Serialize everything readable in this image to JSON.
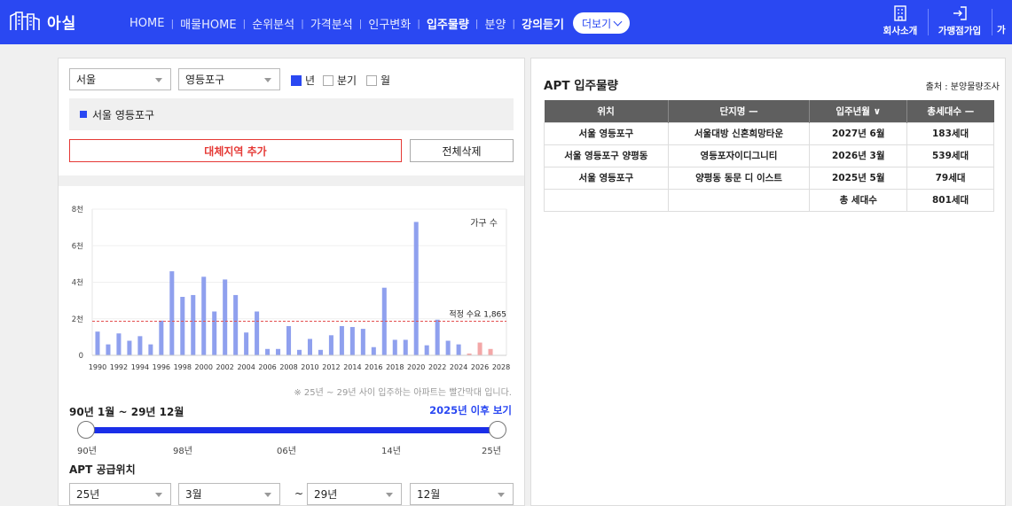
{
  "header": {
    "logo_text": "아실",
    "nav": [
      {
        "label": "HOME",
        "bold": false
      },
      {
        "label": "매물HOME",
        "bold": false
      },
      {
        "label": "순위분석",
        "bold": false
      },
      {
        "label": "가격분석",
        "bold": false
      },
      {
        "label": "인구변화",
        "bold": false
      },
      {
        "label": "입주물량",
        "bold": true
      },
      {
        "label": "분양",
        "bold": false
      },
      {
        "label": "강의듣기",
        "bold": true
      }
    ],
    "more_label": "더보기",
    "company_label": "회사소개",
    "agency_label": "가맹점가입",
    "cut_label": "가"
  },
  "filters": {
    "city": "서울",
    "district": "영등포구",
    "periods": [
      {
        "label": "년",
        "checked": true
      },
      {
        "label": "분기",
        "checked": false
      },
      {
        "label": "월",
        "checked": false
      }
    ]
  },
  "region_item": "서울 영등포구",
  "buttons": {
    "add_region": "대체지역 추가",
    "delete_all": "전체삭제"
  },
  "chart_data": {
    "type": "bar",
    "title": "가구 수",
    "y_ticks": [
      "0",
      "2천",
      "4천",
      "6천",
      "8천"
    ],
    "ylim": [
      0,
      8000
    ],
    "x_labels": [
      "1990",
      "1992",
      "1994",
      "1996",
      "1998",
      "2000",
      "2002",
      "2004",
      "2006",
      "2008",
      "2010",
      "2012",
      "2014",
      "2016",
      "2018",
      "2020",
      "2022",
      "2024",
      "2026",
      "2028"
    ],
    "categories": [
      1990,
      1991,
      1992,
      1993,
      1994,
      1995,
      1996,
      1997,
      1998,
      1999,
      2000,
      2001,
      2002,
      2003,
      2004,
      2005,
      2006,
      2007,
      2008,
      2009,
      2010,
      2011,
      2012,
      2013,
      2014,
      2015,
      2016,
      2017,
      2018,
      2019,
      2020,
      2021,
      2022,
      2023,
      2024,
      2025,
      2026,
      2027,
      2028
    ],
    "values": [
      1300,
      600,
      1200,
      800,
      1050,
      600,
      1900,
      4600,
      3200,
      3300,
      4300,
      2400,
      4150,
      3300,
      1250,
      2400,
      350,
      350,
      1600,
      300,
      900,
      300,
      1100,
      1600,
      1550,
      1450,
      450,
      3700,
      850,
      850,
      7300,
      550,
      1950,
      800,
      600,
      100,
      700,
      350,
      0
    ],
    "future_from": 2025,
    "reference_line": {
      "label": "적정 수요 1,865",
      "value": 1865
    },
    "grid": true,
    "colors": {
      "bar": "#8fa0ee",
      "future": "#f3a7a7",
      "reference": "#e35050"
    }
  },
  "chart_note": "※ 25년 ~ 29년 사이 입주하는 아파트는 빨간막대 입니다.",
  "range": {
    "label": "90년 1월 ~ 29년 12월",
    "after_link": "2025년 이후 보기",
    "ticks": [
      "90년",
      "98년",
      "06년",
      "14년",
      "25년"
    ],
    "start_fraction": 0,
    "end_fraction": 1
  },
  "supply": {
    "label": "APT 공급위치",
    "from_year": "25년",
    "from_month": "3월",
    "tilde": "~",
    "to_year": "29년",
    "to_month": "12월"
  },
  "right_panel": {
    "title": "APT 입주물량",
    "source": "출처 : 분양물량조사",
    "headers": [
      "위치",
      "단지명 —",
      "입주년월 ∨",
      "총세대수 —"
    ],
    "rows": [
      [
        "서울 영등포구",
        "서울대방 신혼희망타운",
        "2027년 6월",
        "183세대"
      ],
      [
        "서울 영등포구 양평동",
        "영등포자이디그니티",
        "2026년 3월",
        "539세대"
      ],
      [
        "서울 영등포구",
        "양평동 동문 디 이스트",
        "2025년 5월",
        "79세대"
      ]
    ],
    "total_label": "총 세대수",
    "total_value": "801세대"
  },
  "colors": {
    "brand": "#2a48f2",
    "accent_red": "#e53935"
  }
}
